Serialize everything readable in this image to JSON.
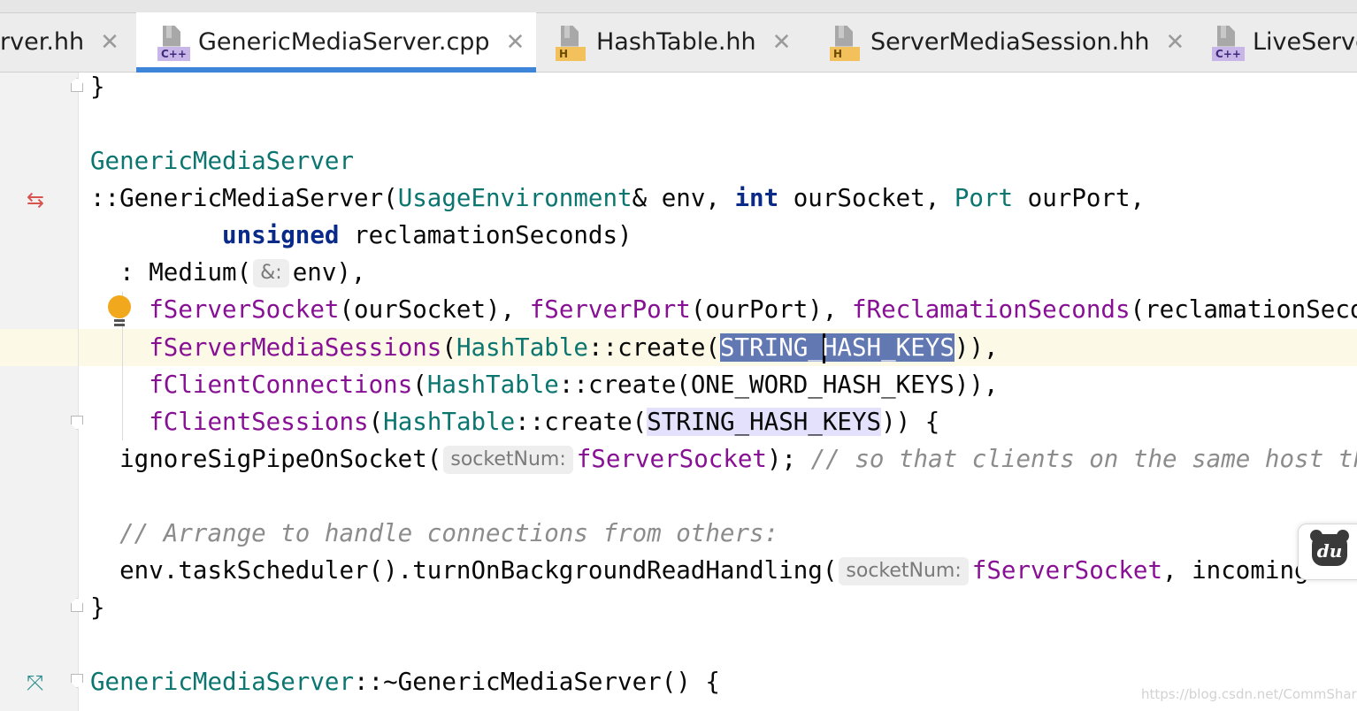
{
  "tabs": [
    {
      "label": "rver.hh",
      "icon": "h-file-icon",
      "active": false
    },
    {
      "label": "GenericMediaServer.cpp",
      "icon": "cpp-file-icon",
      "active": true
    },
    {
      "label": "HashTable.hh",
      "icon": "h-file-icon",
      "active": false
    },
    {
      "label": "ServerMediaSession.hh",
      "icon": "h-file-icon",
      "active": false
    },
    {
      "label": "LiveServe",
      "icon": "cpp-file-icon",
      "active": false
    }
  ],
  "badges": {
    "cpp": "C++",
    "h": "H"
  },
  "close_glyph": "✕",
  "gutter_icons": {
    "override": "⇆",
    "implemented": "⤧"
  },
  "colors": {
    "accent": "#3d85d8",
    "keyword": "#0a2a8a",
    "type": "#0b7670",
    "field": "#871094",
    "comment": "#8c8c8c",
    "selection": "#6178b3"
  },
  "code": {
    "l1": "}",
    "l3": "GenericMediaServer",
    "l4": {
      "a": "::GenericMediaServer(",
      "b": "UsageEnvironment",
      "c": "& env, ",
      "d": "int",
      "e": " ourSocket, ",
      "f": "Port",
      "g": " ourPort,"
    },
    "l5": {
      "a": "         ",
      "b": "unsigned",
      "c": " reclamationSeconds)"
    },
    "l6": {
      "a": "  : Medium(",
      "hint": "&:",
      "b": "env),"
    },
    "l7": {
      "a": "    ",
      "b": "fServerSocket",
      "c": "(ourSocket), ",
      "d": "fServerPort",
      "e": "(ourPort), ",
      "f": "fReclamationSeconds",
      "g": "(reclamationSeconds)"
    },
    "l8": {
      "a": "    ",
      "b": "fServerMediaSessions",
      "c": "(",
      "d": "HashTable",
      "e": "::create(",
      "sel1": "STRING_",
      "sel2": "HASH_KEYS",
      "f": ")),"
    },
    "l9": {
      "a": "    ",
      "b": "fClientConnections",
      "c": "(",
      "d": "HashTable",
      "e": "::create(ONE_WORD_HASH_KEYS)),"
    },
    "l10": {
      "a": "    ",
      "b": "fClientSessions",
      "c": "(",
      "d": "HashTable",
      "e": "::create(",
      "occ": "STRING_HASH_KEYS",
      "f": ")) {"
    },
    "l11": {
      "a": "  ignoreSigPipeOnSocket(",
      "hint": "socketNum:",
      "b": "fServerSocket",
      "c": "); ",
      "d": "// so that clients on the same host that"
    },
    "l13": "  // Arrange to handle connections from others:",
    "l14": {
      "a": "  env.taskScheduler().turnOnBackgroundReadHandling(",
      "hint": "socketNum:",
      "b": "fServerSocket",
      "c": ", incomingConne"
    },
    "l15": "}",
    "l17": {
      "a": "GenericMediaServer",
      "b": "::~GenericMediaServer() {"
    }
  },
  "du_logo": "du",
  "watermark": "https://blog.csdn.net/CommShare"
}
